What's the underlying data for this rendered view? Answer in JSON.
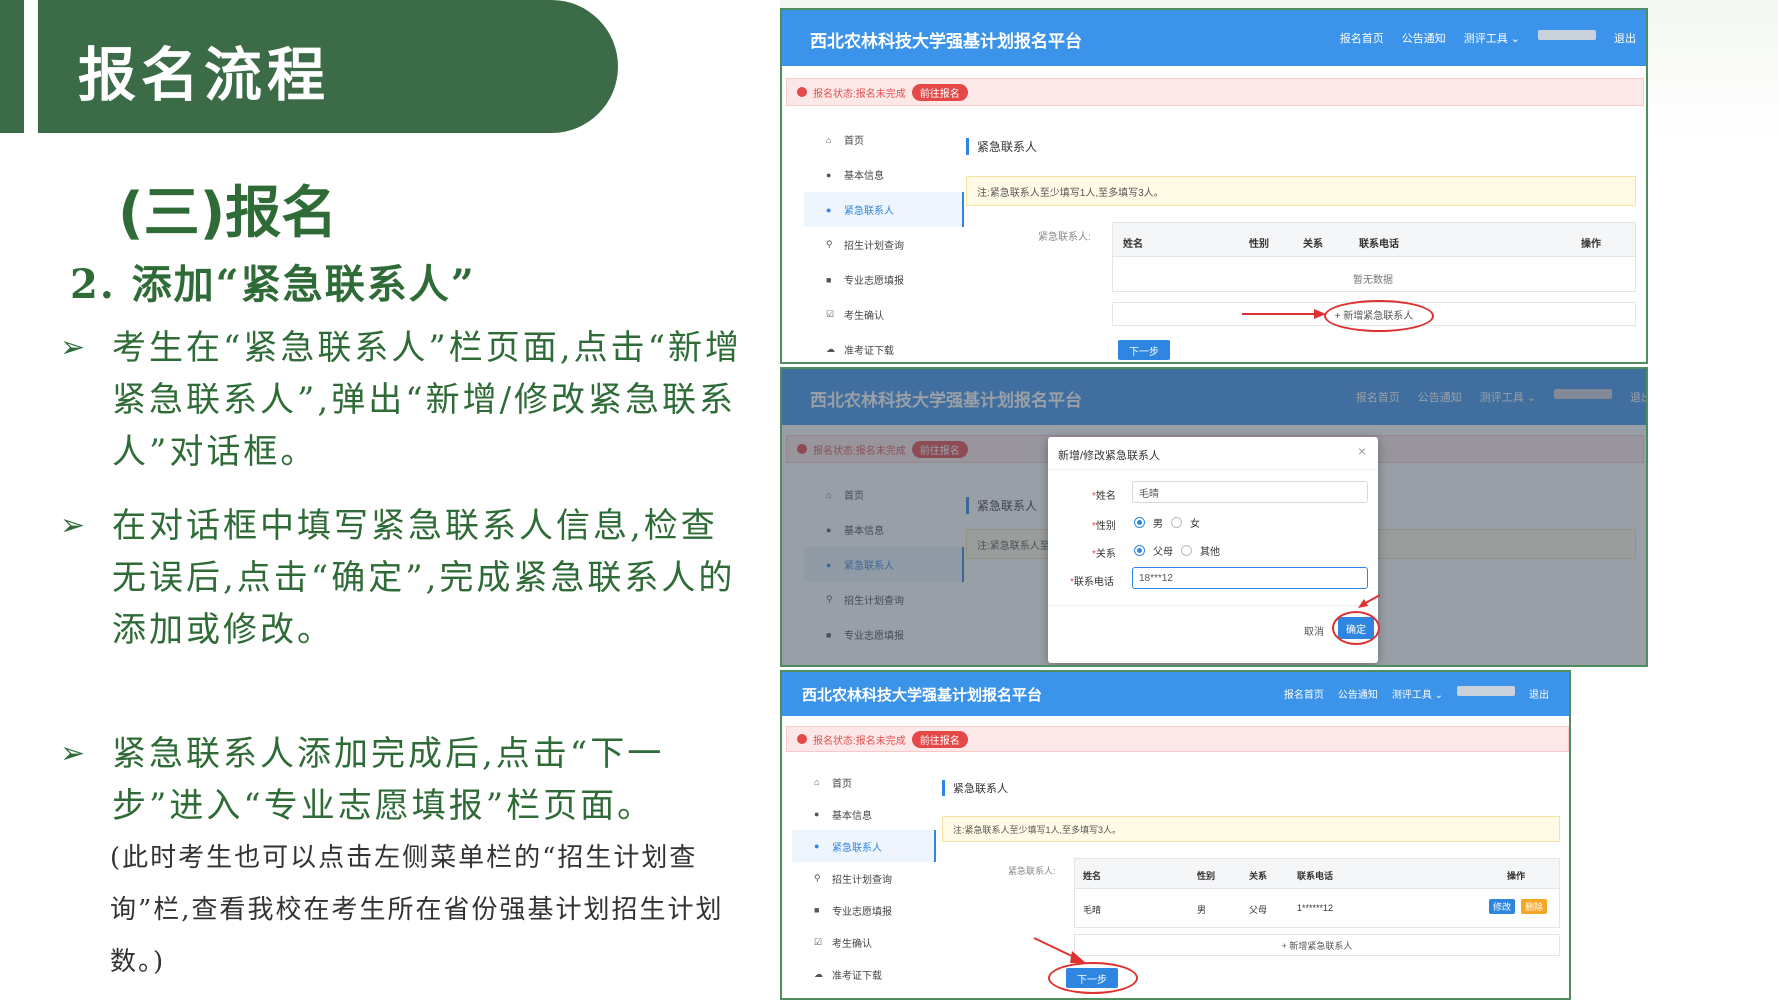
{
  "slide": {
    "banner_title": "报名流程",
    "section_title": "(三)报名",
    "subheading": "2. 添加“紧急联系人”",
    "bullets": [
      {
        "arrow": "➢",
        "text": "考生在“紧急联系人”栏页面,点击“新增紧急联系人”,弹出“新增/修改紧急联系人”对话框。"
      },
      {
        "arrow": "➢",
        "text": "在对话框中填写紧急联系人信息,检查无误后,点击“确定”,完成紧急联系人的添加或修改。"
      },
      {
        "arrow": "➢",
        "text": "紧急联系人添加完成后,点击“下一步”进入“专业志愿填报”栏页面。"
      }
    ],
    "note": "(此时考生也可以点击左侧菜单栏的“招生计划查询”栏,查看我校在考生所在省份强基计划招生计划数。)"
  },
  "app": {
    "title": "西北农林科技大学强基计划报名平台",
    "nav": [
      "报名首页",
      "公告通知",
      "测评工具 ⌄",
      "退出"
    ],
    "status_label": "报名状态:报名未完成",
    "status_button": "前往报名",
    "sidebar": [
      {
        "icon": "home-icon",
        "glyph": "⌂",
        "label": "首页"
      },
      {
        "icon": "user-icon",
        "glyph": "●",
        "label": "基本信息"
      },
      {
        "icon": "contact-icon",
        "glyph": "●",
        "label": "紧急联系人"
      },
      {
        "icon": "search-icon",
        "glyph": "⚲",
        "label": "招生计划查询"
      },
      {
        "icon": "form-icon",
        "glyph": "■",
        "label": "专业志愿填报"
      },
      {
        "icon": "check-icon",
        "glyph": "☑",
        "label": "考生确认"
      },
      {
        "icon": "download-icon",
        "glyph": "☁",
        "label": "准考证下载"
      }
    ],
    "page_title": "紧急联系人",
    "notice": "注:紧急联系人至少填写1人,至多填写3人。",
    "contacts_label": "紧急联系人:",
    "columns": [
      "姓名",
      "性别",
      "关系",
      "联系电话",
      "操作"
    ],
    "empty_text": "暂无数据",
    "add_button": "+ 新增紧急联系人",
    "next_button": "下一步",
    "dialog": {
      "title": "新增/修改紧急联系人",
      "close": "×",
      "name_label": "姓名",
      "name_value": "毛晴",
      "gender_label": "性别",
      "gender_options": [
        "男",
        "女"
      ],
      "relation_label": "关系",
      "relation_options": [
        "父母",
        "其他"
      ],
      "phone_label": "联系电话",
      "phone_value": "18***12",
      "cancel": "取消",
      "confirm": "确定"
    },
    "row": {
      "name": "毛晴",
      "gender": "男",
      "relation": "父母",
      "phone": "1******12",
      "edit": "修改",
      "delete": "删除"
    }
  },
  "colors": {
    "brand_green": "#3c6b47",
    "text_green": "#2e6b36",
    "header_blue": "#3b93ea",
    "alert_red": "#e54848"
  }
}
